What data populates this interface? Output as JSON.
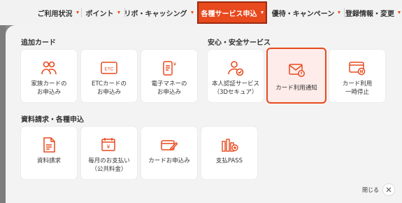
{
  "nav": {
    "items": [
      {
        "label": "ご利用状況",
        "active": false
      },
      {
        "label": "ポイント",
        "active": false
      },
      {
        "label": "リボ・キャッシング",
        "active": false
      },
      {
        "label": "各種サービス申込",
        "active": true
      },
      {
        "label": "優待・キャンペーン",
        "active": false
      },
      {
        "label": "登録情報・変更",
        "active": false
      }
    ]
  },
  "sections": {
    "additional_cards": {
      "title": "追加カード",
      "cards": [
        {
          "label": "家族カードの\nお申込み",
          "icon": "family-icon"
        },
        {
          "label": "ETCカードの\nお申込み",
          "icon": "etc-card-icon"
        },
        {
          "label": "電子マネーの\nお申込み",
          "icon": "e-money-icon"
        }
      ]
    },
    "security": {
      "title": "安心・安全サービス",
      "cards": [
        {
          "label": "本人認証サービス\n（3Dセキュア）",
          "icon": "person-check-icon"
        },
        {
          "label": "カード利用通知",
          "icon": "mail-notification-icon",
          "selected": true
        },
        {
          "label": "カード利用\n一時停止",
          "icon": "card-pause-icon"
        }
      ]
    },
    "documents": {
      "title": "資料請求・各種申込",
      "cards": [
        {
          "label": "資料請求",
          "icon": "document-icon"
        },
        {
          "label": "毎月のお支払い\n（公共料金）",
          "icon": "calendar-yen-icon"
        },
        {
          "label": "カードお申込み",
          "icon": "card-pen-icon"
        },
        {
          "label": "支払PASS",
          "icon": "pass-icon"
        }
      ]
    }
  },
  "close": {
    "label": "閉じる",
    "icon": "close-icon"
  },
  "colors": {
    "accent": "#e8491d",
    "panel": "#f3f3f3",
    "selected_bg": "#fdecea"
  }
}
